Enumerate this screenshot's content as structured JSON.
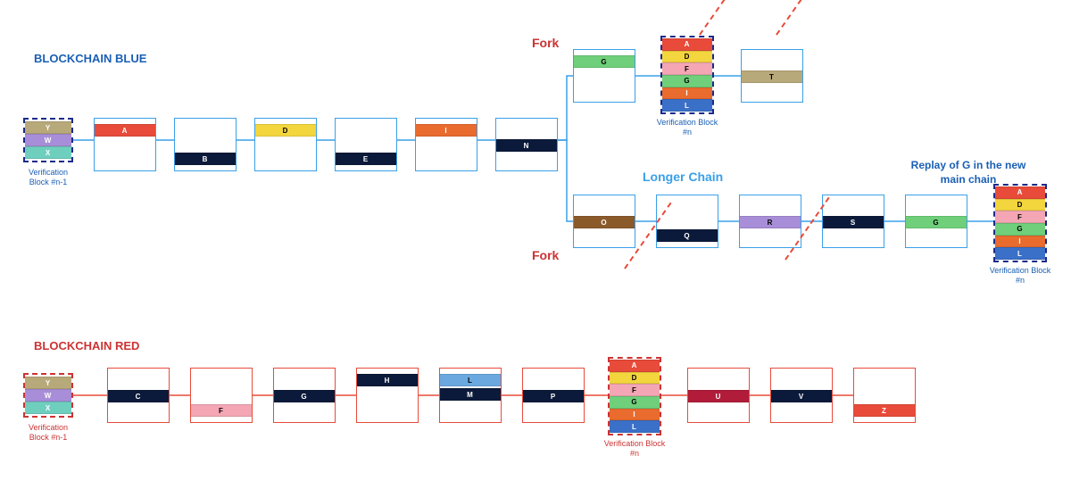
{
  "colors": {
    "red": "#e84b3a",
    "darkred": "#b01c3a",
    "green": "#6fcf7a",
    "yellow": "#f3d63e",
    "orange": "#e96b2e",
    "navy": "#0b1a3a",
    "khaki": "#b8a97a",
    "purple": "#a88ed8",
    "teal": "#6fcfbf",
    "skyblue": "#6ba8e0",
    "pink": "#f4a6b4",
    "brown": "#8b5a2b",
    "blue": "#3a70c8"
  },
  "titles": {
    "blue": "BLOCKCHAIN BLUE",
    "red": "BLOCKCHAIN RED"
  },
  "labels": {
    "fork": "Fork",
    "longer": "Longer Chain",
    "replay": "Replay of G in the new main chain",
    "verif_n1": "Verification Block #n-1",
    "verif_n": "Verification Block #n"
  },
  "blue": {
    "verif_n1": [
      {
        "t": "Y",
        "c": "khaki"
      },
      {
        "t": "W",
        "c": "purple"
      },
      {
        "t": "X",
        "c": "teal"
      }
    ],
    "chain": [
      {
        "t": "A",
        "c": "red",
        "pos": "top"
      },
      {
        "t": "B",
        "c": "navy",
        "pos": "bot"
      },
      {
        "t": "D",
        "c": "yellow",
        "pos": "top",
        "dark": true
      },
      {
        "t": "E",
        "c": "navy",
        "pos": "bot"
      },
      {
        "t": "I",
        "c": "orange",
        "pos": "top"
      },
      {
        "t": "N",
        "c": "navy",
        "pos": "mid"
      }
    ],
    "fork_up": {
      "t": "G",
      "c": "green",
      "pos": "top",
      "dark": true
    },
    "verif_up": [
      {
        "t": "A",
        "c": "red"
      },
      {
        "t": "D",
        "c": "yellow",
        "dark": true
      },
      {
        "t": "F",
        "c": "pink",
        "dark": true
      },
      {
        "t": "G",
        "c": "green",
        "dark": true
      },
      {
        "t": "I",
        "c": "orange"
      },
      {
        "t": "L",
        "c": "blue"
      }
    ],
    "fork_up_after": {
      "t": "T",
      "c": "khaki",
      "pos": "mid",
      "dark": true
    },
    "fork_down": [
      {
        "t": "O",
        "c": "brown",
        "pos": "mid"
      },
      {
        "t": "Q",
        "c": "navy",
        "pos": "bot"
      },
      {
        "t": "R",
        "c": "purple",
        "pos": "mid",
        "dark": true
      },
      {
        "t": "S",
        "c": "navy",
        "pos": "mid"
      },
      {
        "t": "G",
        "c": "green",
        "pos": "mid",
        "dark": true
      }
    ],
    "verif_down": [
      {
        "t": "A",
        "c": "red"
      },
      {
        "t": "D",
        "c": "yellow",
        "dark": true
      },
      {
        "t": "F",
        "c": "pink",
        "dark": true
      },
      {
        "t": "G",
        "c": "green",
        "dark": true
      },
      {
        "t": "I",
        "c": "orange"
      },
      {
        "t": "L",
        "c": "blue"
      }
    ]
  },
  "red": {
    "verif_n1": [
      {
        "t": "Y",
        "c": "khaki"
      },
      {
        "t": "W",
        "c": "purple"
      },
      {
        "t": "X",
        "c": "teal"
      }
    ],
    "chain": [
      {
        "t": "C",
        "c": "navy",
        "pos": "mid"
      },
      {
        "t": "F",
        "c": "pink",
        "pos": "bot",
        "dark": true
      },
      {
        "t": "G",
        "c": "navy",
        "pos": "mid"
      },
      {
        "t": "H",
        "c": "navy",
        "pos": "top"
      },
      {
        "t": "L",
        "c": "skyblue",
        "pos": "top",
        "dark": true,
        "extra": {
          "t": "M",
          "c": "navy"
        }
      },
      {
        "t": "P",
        "c": "navy",
        "pos": "mid"
      }
    ],
    "verif_n": [
      {
        "t": "A",
        "c": "red"
      },
      {
        "t": "D",
        "c": "yellow",
        "dark": true
      },
      {
        "t": "F",
        "c": "pink",
        "dark": true
      },
      {
        "t": "G",
        "c": "green",
        "dark": true
      },
      {
        "t": "I",
        "c": "orange"
      },
      {
        "t": "L",
        "c": "blue"
      }
    ],
    "chain2": [
      {
        "t": "U",
        "c": "darkred",
        "pos": "mid"
      },
      {
        "t": "V",
        "c": "navy",
        "pos": "mid"
      },
      {
        "t": "Z",
        "c": "red",
        "pos": "bot"
      }
    ]
  }
}
